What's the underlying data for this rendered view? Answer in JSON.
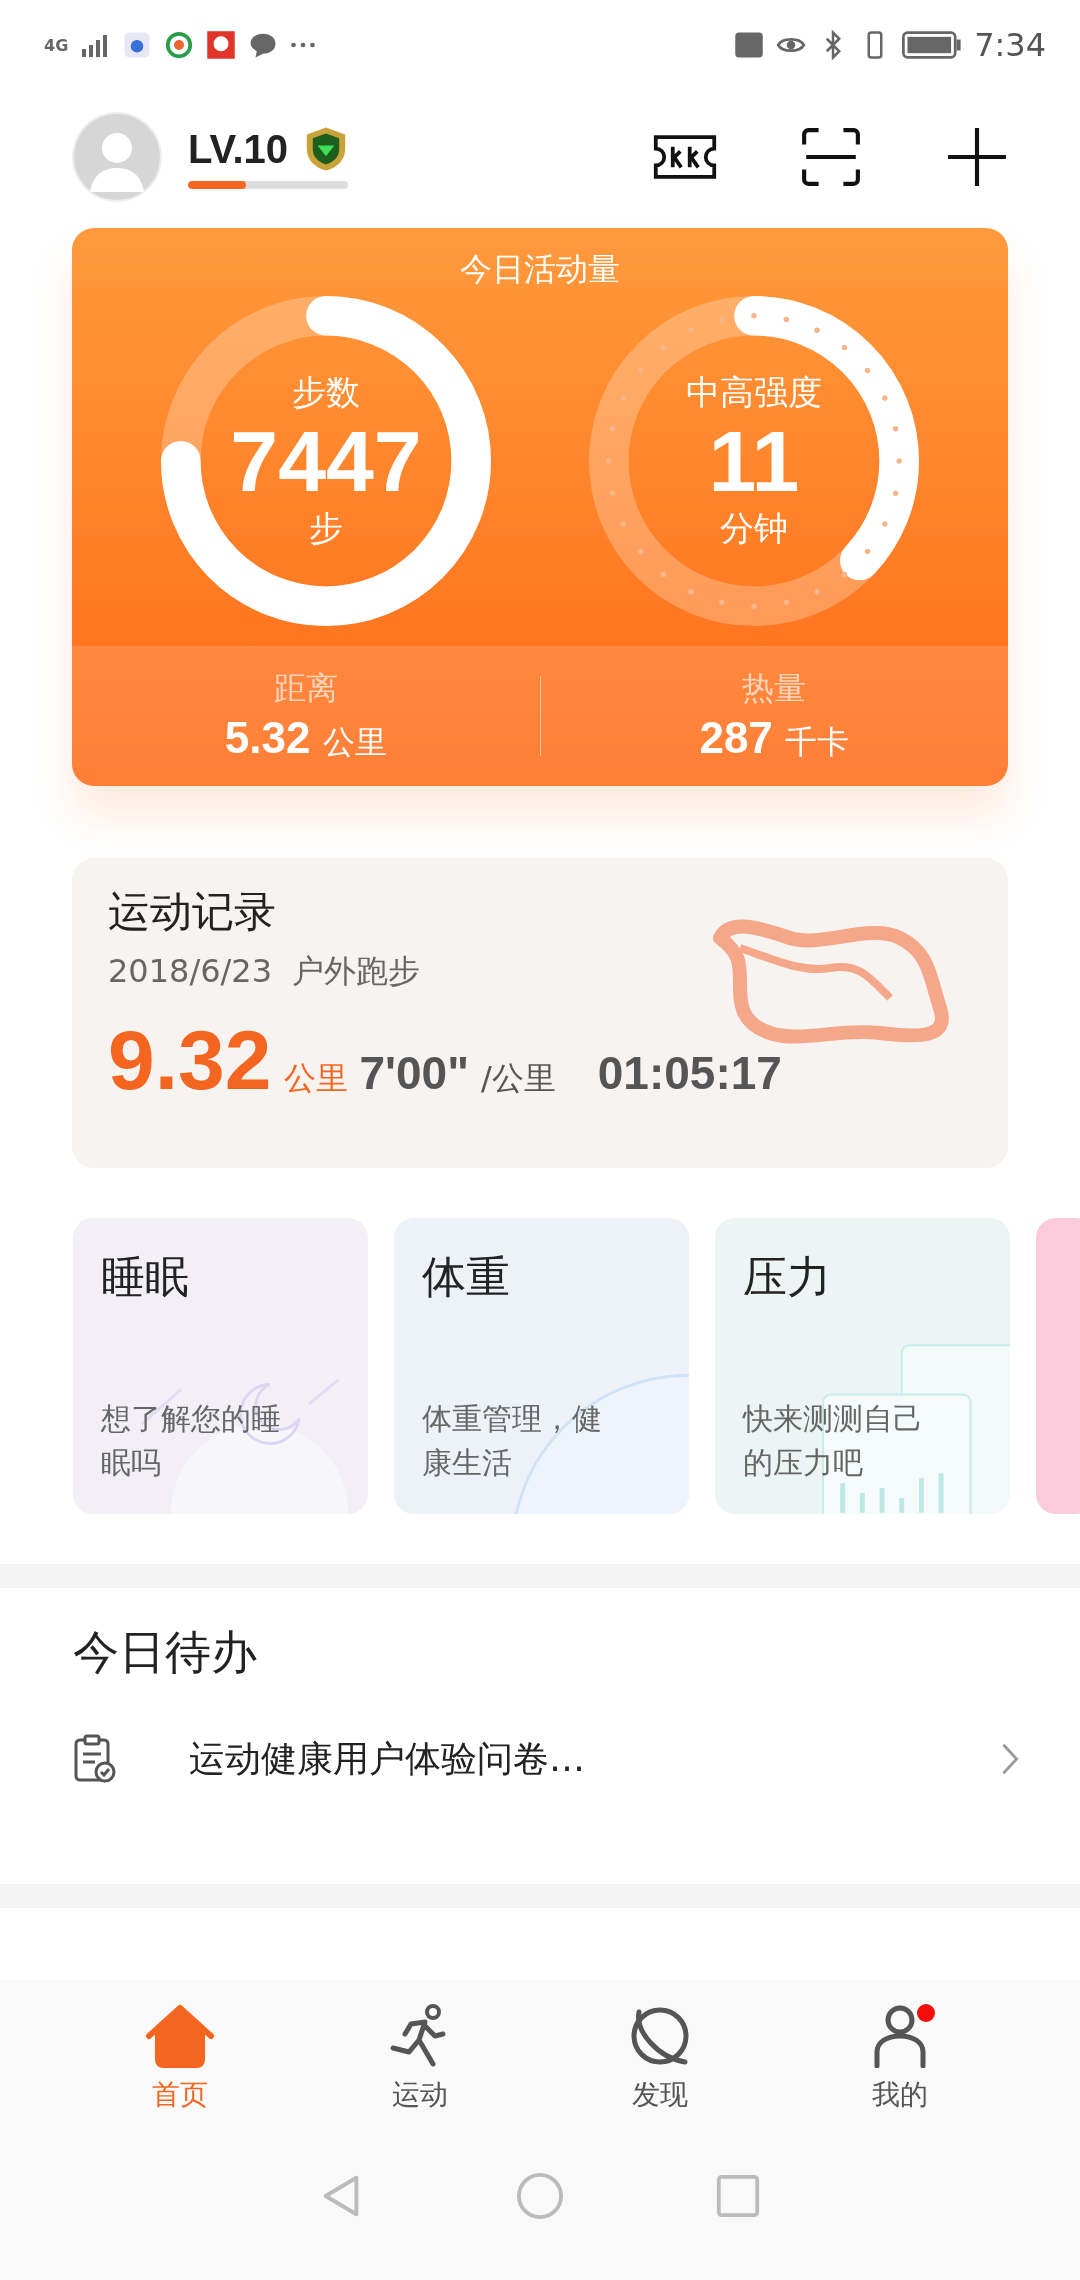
{
  "status_bar": {
    "network": "4G",
    "time": "7:34"
  },
  "header": {
    "level_label": "LV.10",
    "exp": {
      "level": 0.36
    }
  },
  "activity": {
    "title": "今日活动量",
    "steps": {
      "label": "步数",
      "value": "7447",
      "unit": "步",
      "level": 0.75
    },
    "intensity": {
      "label": "中高强度",
      "value": "11",
      "unit": "分钟",
      "level": 0.37
    },
    "stats": [
      {
        "label": "距离",
        "value": "5.32",
        "unit": "公里"
      },
      {
        "label": "热量",
        "value": "287",
        "unit": "千卡"
      }
    ]
  },
  "record": {
    "title": "运动记录",
    "date": "2018/6/23",
    "type": "户外跑步",
    "distance": "9.32",
    "distance_unit": "公里",
    "pace": "7'00\"",
    "pace_unit": "/公里",
    "duration": "01:05:17"
  },
  "cards": [
    {
      "kind": "sleep",
      "title": "睡眠",
      "text": "想了解您的睡眠吗"
    },
    {
      "kind": "weight",
      "title": "体重",
      "text": "体重管理，健康生活"
    },
    {
      "kind": "stress",
      "title": "压力",
      "text": "快来测测自己的压力吧"
    },
    {
      "kind": "partial"
    }
  ],
  "todo": {
    "title": "今日待办",
    "items": [
      {
        "text": "运动健康用户体验问卷…"
      }
    ]
  },
  "nav": [
    {
      "label": "首页",
      "selected": true,
      "badge": false
    },
    {
      "label": "运动",
      "selected": false,
      "badge": false
    },
    {
      "label": "发现",
      "selected": false,
      "badge": false
    },
    {
      "label": "我的",
      "selected": false,
      "badge": true
    }
  ]
}
